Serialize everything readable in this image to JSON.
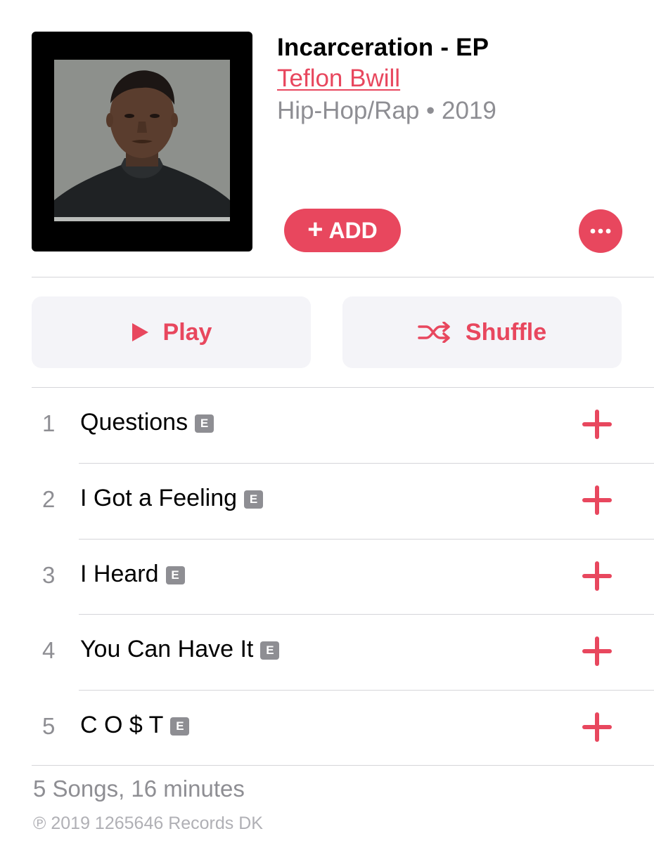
{
  "album": {
    "title": "Incarceration - EP",
    "artist": "Teflon Bwill",
    "meta": "Hip-Hop/Rap • 2019",
    "artwork_icon": "album-artwork"
  },
  "actions": {
    "add_plus": "+",
    "add_label": "ADD",
    "more_icon": "ellipsis-icon",
    "play_label": "Play",
    "play_icon": "play-icon",
    "shuffle_label": "Shuffle",
    "shuffle_icon": "shuffle-icon"
  },
  "tracks": [
    {
      "number": "1",
      "title": "Questions",
      "explicit": "E"
    },
    {
      "number": "2",
      "title": "I Got a Feeling",
      "explicit": "E"
    },
    {
      "number": "3",
      "title": "I Heard",
      "explicit": "E"
    },
    {
      "number": "4",
      "title": "You Can Have It",
      "explicit": "E"
    },
    {
      "number": "5",
      "title": "C O $ T",
      "explicit": "E"
    }
  ],
  "footer": {
    "summary": "5 Songs, 16 minutes",
    "copyright": "℗ 2019 1265646 Records DK"
  },
  "colors": {
    "accent": "#e8475e",
    "secondary_text": "#8e8e93",
    "button_bg": "#f4f4f8"
  }
}
